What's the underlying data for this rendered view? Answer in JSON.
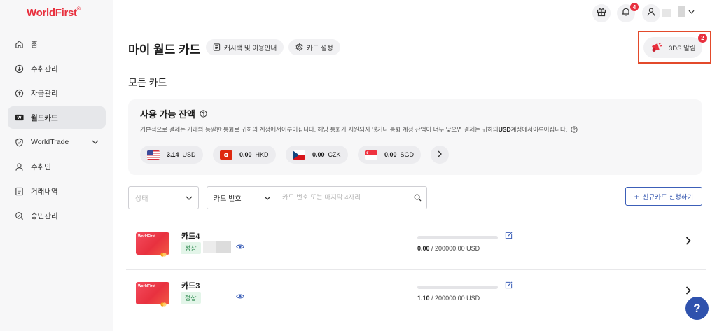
{
  "brand": {
    "name": "WorldFirst",
    "mark": "®"
  },
  "sidebar": {
    "items": [
      {
        "label": "홈",
        "icon": "home-icon"
      },
      {
        "label": "수취관리",
        "icon": "receive-icon"
      },
      {
        "label": "자금관리",
        "icon": "funds-icon"
      },
      {
        "label": "월드카드",
        "icon": "card-icon",
        "active": true
      },
      {
        "label": "WorldTrade",
        "icon": "shield-icon",
        "expandable": true
      },
      {
        "label": "수취인",
        "icon": "user-icon"
      },
      {
        "label": "거래내역",
        "icon": "list-icon"
      },
      {
        "label": "승인관리",
        "icon": "approval-icon"
      }
    ]
  },
  "header": {
    "notifications_count": "4"
  },
  "page": {
    "title": "마이 월드 카드",
    "cashback_label": "캐시백 및 이용안내",
    "settings_label": "카드 설정",
    "alert_label": "3DS 알림",
    "alert_count": "2",
    "section_title": "모든 카드"
  },
  "balance": {
    "title": "사용 가능 잔액",
    "desc_pre": "기본적으로 결제는 거래와 동일한 통화로 귀하의 계정에서이루어집니다. 해당 통화가 지원되지 않거나 통화 계정 잔액이 너무 낮으면 결제는 귀하의 ",
    "desc_bold": "USD",
    "desc_post": " 계정에서이루어집니다.",
    "currencies": [
      {
        "amount": "3.14",
        "code": "USD",
        "flag": "us-flag"
      },
      {
        "amount": "0.00",
        "code": "HKD",
        "flag": "hk-flag"
      },
      {
        "amount": "0.00",
        "code": "CZK",
        "flag": "cz-flag"
      },
      {
        "amount": "0.00",
        "code": "SGD",
        "flag": "sg-flag"
      }
    ]
  },
  "filters": {
    "status_placeholder": "상태",
    "field_select": "카드 번호",
    "search_placeholder": "카드 번호 또는 마지막 4자리",
    "new_card_label": "신규카드 신청하기"
  },
  "cards": [
    {
      "name": "카드4",
      "status": "정상",
      "used": "0.00",
      "limit": "/ 200000.00 USD",
      "usage_fraction": 0
    },
    {
      "name": "카드3",
      "status": "정상",
      "used": "1.10",
      "limit": "/ 200000.00 USD",
      "usage_fraction": 0
    }
  ],
  "card_brand_text": "WorldFirst",
  "help_label": "?",
  "colors": {
    "brand": "#e8303e",
    "accent": "#2f52ad",
    "alert_border": "#e34a2b"
  }
}
